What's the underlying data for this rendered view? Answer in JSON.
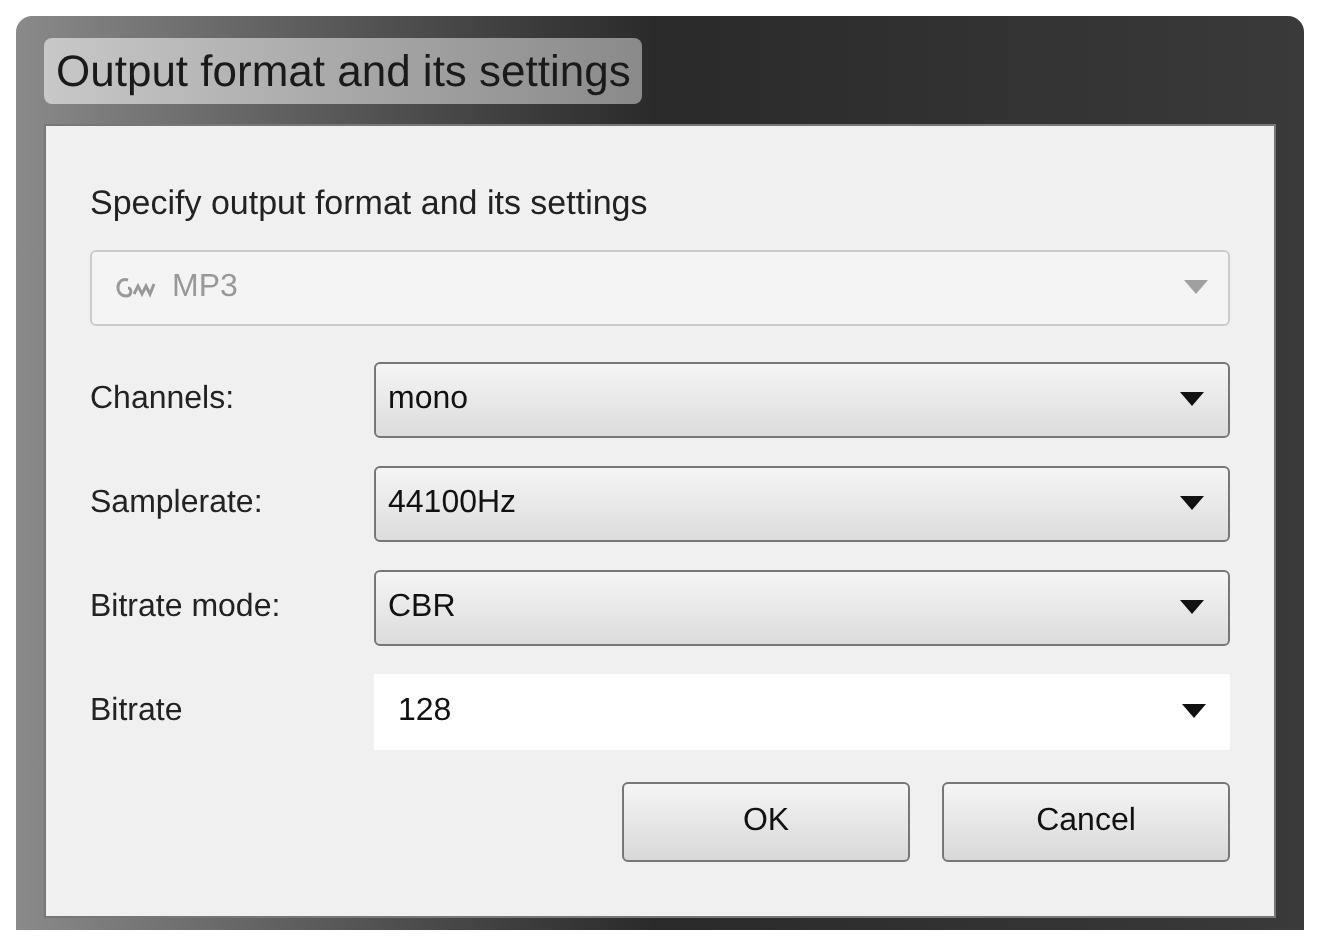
{
  "window": {
    "title": "Output format and its settings"
  },
  "heading": "Specify output format and its settings",
  "format": {
    "value": "MP3",
    "disabled": true
  },
  "settings": [
    {
      "label": "Channels:",
      "value": "mono",
      "kind": "dropdown"
    },
    {
      "label": "Samplerate:",
      "value": "44100Hz",
      "kind": "dropdown"
    },
    {
      "label": "Bitrate mode:",
      "value": "CBR",
      "kind": "dropdown"
    },
    {
      "label": "Bitrate",
      "value": "128",
      "kind": "editable"
    }
  ],
  "buttons": [
    "OK",
    "Cancel"
  ]
}
